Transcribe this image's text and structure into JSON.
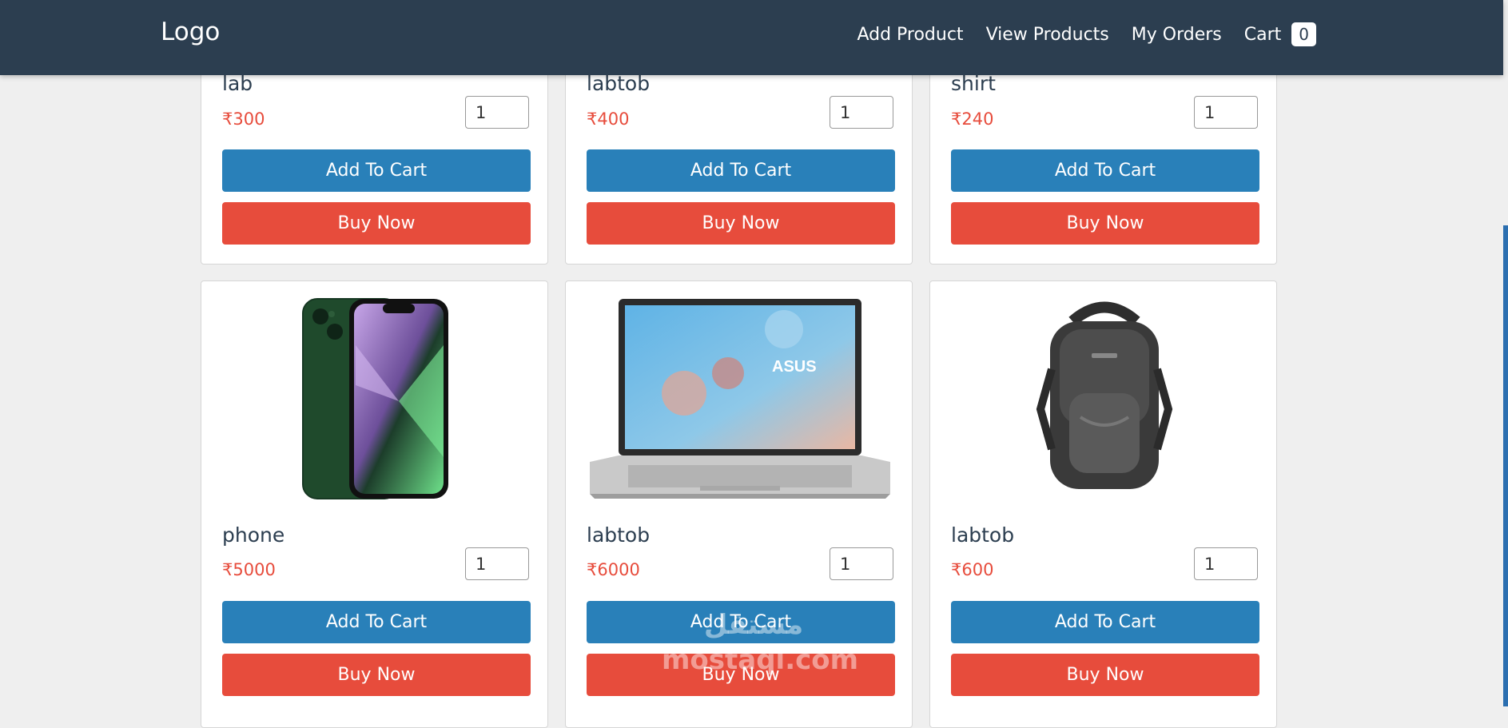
{
  "navbar": {
    "logo": "Logo",
    "links": [
      "Add Product",
      "View Products",
      "My Orders"
    ],
    "cart_label": "Cart",
    "cart_count": "0"
  },
  "products": [
    {
      "name": "lab",
      "price": "₹300",
      "qty": "1",
      "add_label": "Add To Cart",
      "buy_label": "Buy Now"
    },
    {
      "name": "labtob",
      "price": "₹400",
      "qty": "1",
      "add_label": "Add To Cart",
      "buy_label": "Buy Now"
    },
    {
      "name": "shirt",
      "price": "₹240",
      "qty": "1",
      "add_label": "Add To Cart",
      "buy_label": "Buy Now"
    },
    {
      "name": "phone",
      "price": "₹5000",
      "qty": "1",
      "add_label": "Add To Cart",
      "buy_label": "Buy Now",
      "image": "phone-image"
    },
    {
      "name": "labtob",
      "price": "₹6000",
      "qty": "1",
      "add_label": "Add To Cart",
      "buy_label": "Buy Now",
      "image": "laptop-image"
    },
    {
      "name": "labtob",
      "price": "₹600",
      "qty": "1",
      "add_label": "Add To Cart",
      "buy_label": "Buy Now",
      "image": "backpack-image"
    }
  ],
  "watermark": {
    "line1": "مستقل",
    "line2": "mostaql.com"
  },
  "colors": {
    "navbar": "#2c3e50",
    "add_to_cart": "#2980b9",
    "buy_now": "#e74c3c",
    "price": "#e74c3c"
  }
}
